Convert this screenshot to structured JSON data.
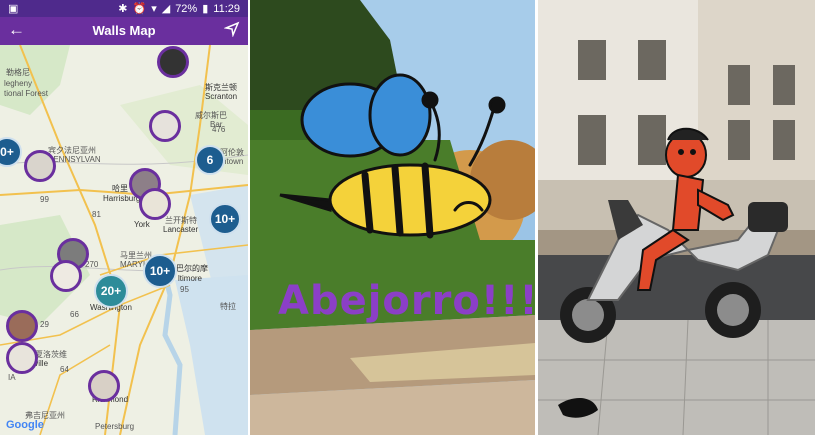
{
  "status_bar": {
    "battery": "72%",
    "time": "11:29"
  },
  "app_bar": {
    "title": "Walls Map"
  },
  "map": {
    "labels": {
      "forest_cn": "勒格尼",
      "forest_en1": "legheny",
      "forest_en2": "tional Forest",
      "scranton_cn": "斯克兰顿",
      "scranton_en": "Scranton",
      "wil_cn": "威尔斯巴",
      "bar": "Bar",
      "state_cn": "宾夕法尼亚州",
      "state_en": "PENNSYLVAN",
      "allentown_cn": "阿伦敦",
      "allentown_en": "ntown",
      "harrisburg_cn": "哈里",
      "harrisburg_en": "Harrisburg",
      "lancaster_cn": "兰开斯特",
      "lancaster_en": "Lancaster",
      "york": "York",
      "maryland_cn": "马里兰州",
      "maryland_en": "MARYLAND",
      "baltimore_cn": "巴尔的摩",
      "baltimore_en": "ltimore",
      "washington": "Washington",
      "delaware_cn": "特拉",
      "charlottesville_cn": "夏洛茨维",
      "charlottesville_en": "arlottesville",
      "richmond": "Richmond",
      "virginia_cn": "弗吉尼亚州",
      "petersburg": "Petersburg",
      "ia": "IA",
      "route_476": "476",
      "route_99": "99",
      "route_81": "81",
      "route_95": "95",
      "route_64": "64",
      "route_66": "66",
      "route_270": "270",
      "route_29": "29",
      "brand": "Google"
    },
    "clusters": [
      {
        "label": "6"
      },
      {
        "label": "10+"
      },
      {
        "label": "10+"
      },
      {
        "label": "20+"
      },
      {
        "label": "0+"
      }
    ]
  },
  "drawing": {
    "caption": "Abejorro!!!"
  },
  "colors": {
    "status_bar": "#4f2a8c",
    "app_bar": "#6a2f9e",
    "cluster": "#1d5d8f",
    "cluster_teal": "#2d8c99",
    "caption": "#8b3fc7"
  }
}
